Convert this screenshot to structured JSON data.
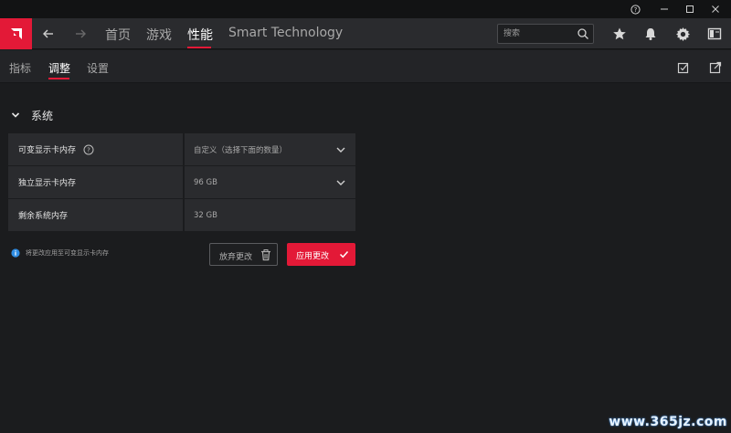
{
  "titlebar": {
    "controls": [
      {
        "icon": "help-circle-icon",
        "glyph": "?"
      },
      {
        "icon": "minimize-icon",
        "glyph": "—"
      },
      {
        "icon": "maximize-icon",
        "glyph": "□"
      },
      {
        "icon": "close-icon",
        "glyph": "✕"
      }
    ]
  },
  "nav": {
    "tabs": [
      {
        "label": "首页"
      },
      {
        "label": "游戏"
      },
      {
        "label": "性能",
        "active": true
      },
      {
        "label": "Smart Technology"
      }
    ],
    "search_placeholder": "搜索",
    "tool_icons": [
      "star-icon",
      "bell-icon",
      "gear-icon",
      "sidebar-panel-icon"
    ],
    "accent": "#e31937"
  },
  "subnav": {
    "tabs": [
      {
        "label": "指标"
      },
      {
        "label": "调整",
        "active": true
      },
      {
        "label": "设置"
      }
    ],
    "icons": [
      "edit-check-icon",
      "share-export-icon"
    ]
  },
  "main": {
    "section_title": "系统",
    "rows": [
      {
        "label": "可变显示卡内存",
        "value": "自定义（选择下面的数量）",
        "has_help": true,
        "has_dropdown": true
      },
      {
        "label": "独立显示卡内存",
        "value": "96 GB",
        "has_help": false,
        "has_dropdown": true
      },
      {
        "label": "剩余系统内存",
        "value": "32 GB",
        "has_help": false,
        "has_dropdown": false
      }
    ],
    "info_text": "将更改应用至可变显示卡内存",
    "discard_label": "放弃更改",
    "apply_label": "应用更改"
  },
  "watermark": "www.365jz.com"
}
